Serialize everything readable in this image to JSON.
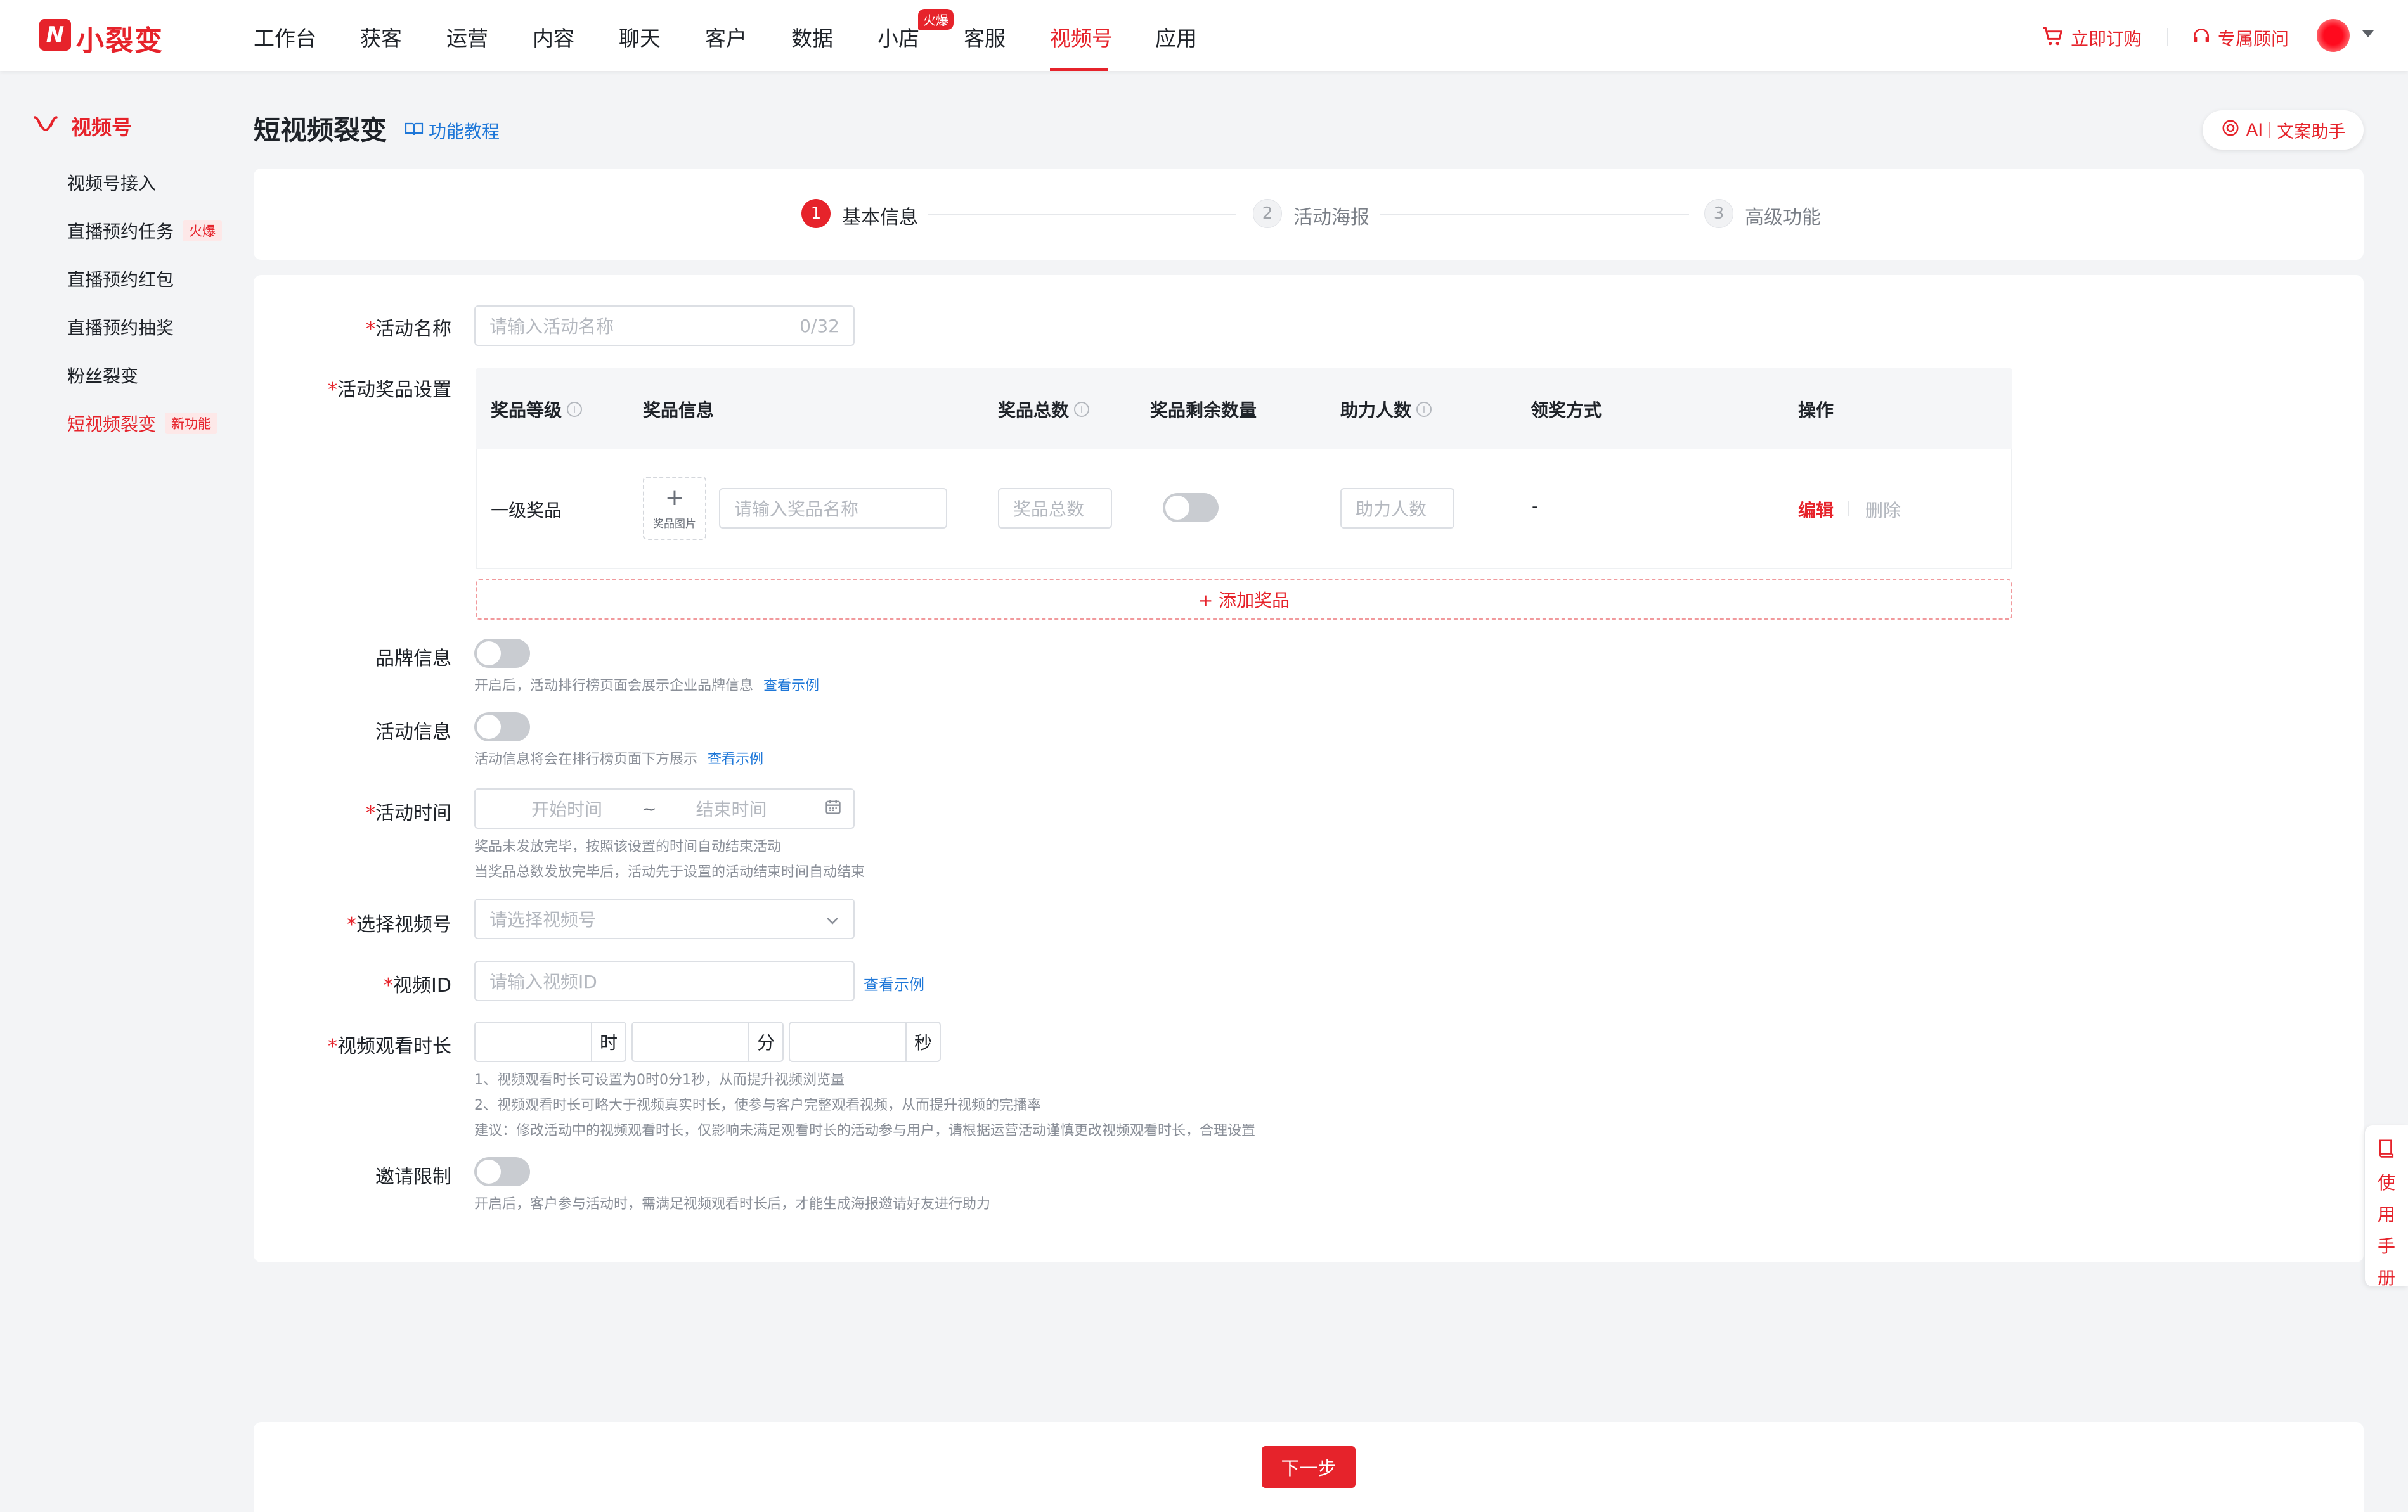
{
  "brand": {
    "name": "小裂变",
    "logo_glyph": "N"
  },
  "nav": {
    "items": [
      "工作台",
      "获客",
      "运营",
      "内容",
      "聊天",
      "客户",
      "数据",
      "小店",
      "客服",
      "视频号",
      "应用"
    ],
    "active": "视频号",
    "hot_badge": "火爆"
  },
  "topright": {
    "order": "立即订购",
    "advisor": "专属顾问"
  },
  "sidebar": {
    "header": "视频号",
    "items": [
      {
        "label": "视频号接入"
      },
      {
        "label": "直播预约任务",
        "tag": "火爆"
      },
      {
        "label": "直播预约红包"
      },
      {
        "label": "直播预约抽奖"
      },
      {
        "label": "粉丝裂变"
      },
      {
        "label": "短视频裂变",
        "tag": "新功能"
      }
    ]
  },
  "page": {
    "title": "短视频裂变",
    "tutorial": "功能教程",
    "ai_assist": {
      "ai": "AI",
      "label": "文案助手"
    }
  },
  "steps": [
    {
      "num": "1",
      "label": "基本信息",
      "active": true
    },
    {
      "num": "2",
      "label": "活动海报",
      "active": false
    },
    {
      "num": "3",
      "label": "高级功能",
      "active": false
    }
  ],
  "form": {
    "required_mark": "*",
    "name": {
      "label": "活动名称",
      "placeholder": "请输入活动名称",
      "counter": "0/32"
    },
    "prizes": {
      "label": "活动奖品设置",
      "columns": [
        "奖品等级",
        "奖品信息",
        "奖品总数",
        "奖品剩余数量",
        "助力人数",
        "领奖方式",
        "操作"
      ],
      "row": {
        "level": "一级奖品",
        "upload_plus": "+",
        "upload_label": "奖品图片",
        "name_placeholder": "请输入奖品名称",
        "total_placeholder": "奖品总数",
        "helpers_placeholder": "助力人数",
        "claim_method": "-",
        "edit": "编辑",
        "delete": "删除"
      },
      "add": "+ 添加奖品"
    },
    "brand_info": {
      "label": "品牌信息",
      "hint": "开启后，活动排行榜页面会展示企业品牌信息",
      "link": "查看示例"
    },
    "activity_info": {
      "label": "活动信息",
      "hint": "活动信息将会在排行榜页面下方展示",
      "link": "查看示例"
    },
    "time": {
      "label": "活动时间",
      "start": "开始时间",
      "sep": "~",
      "end": "结束时间",
      "hint1": "奖品未发放完毕，按照该设置的时间自动结束活动",
      "hint2": "当奖品总数发放完毕后，活动先于设置的活动结束时间自动结束"
    },
    "channel": {
      "label": "选择视频号",
      "placeholder": "请选择视频号"
    },
    "video_id": {
      "label": "视频ID",
      "placeholder": "请输入视频ID",
      "link": "查看示例"
    },
    "watch": {
      "label": "视频观看时长",
      "units": [
        "时",
        "分",
        "秒"
      ],
      "hint1": "1、视频观看时长可设置为0时0分1秒，从而提升视频浏览量",
      "hint2": "2、视频观看时长可略大于视频真实时长，使参与客户完整观看视频，从而提升视频的完播率",
      "hint3": "建议：修改活动中的视频观看时长，仅影响未满足观看时长的活动参与用户，请根据运营活动谨慎更改视频观看时长，合理设置"
    },
    "invite": {
      "label": "邀请限制",
      "hint": "开启后，客户参与活动时，需满足视频观看时长后，才能生成海报邀请好友进行助力"
    }
  },
  "footer": {
    "next": "下一步"
  },
  "manual": [
    "使",
    "用",
    "手",
    "册"
  ],
  "colors": {
    "accent": "#e6232b",
    "link": "#1e77d8",
    "background": "#f3f4f6"
  }
}
